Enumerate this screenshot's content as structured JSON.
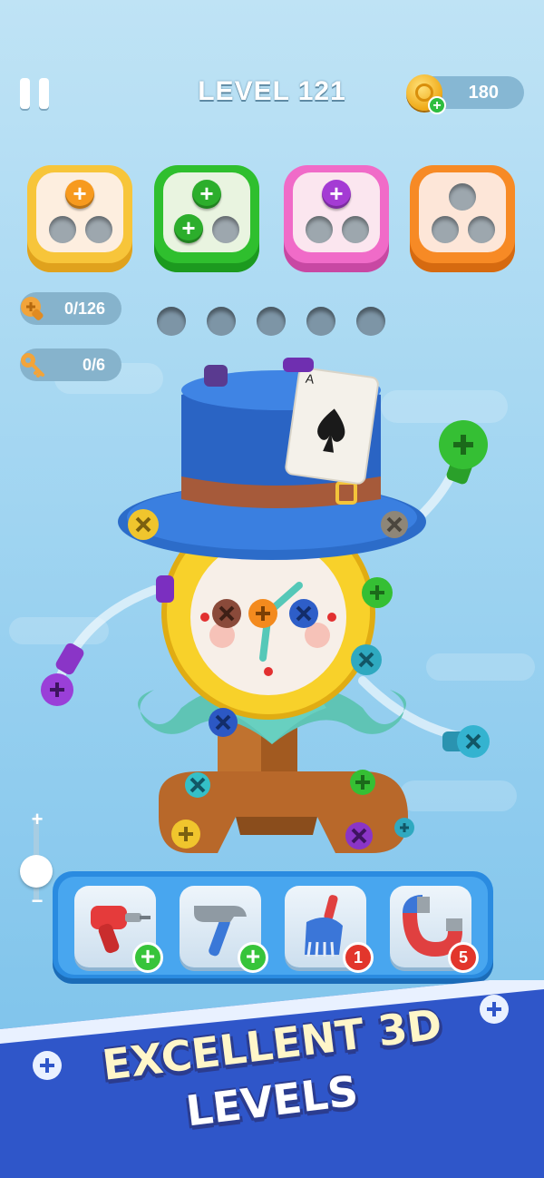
{
  "hud": {
    "level_label": "LEVEL 121",
    "coins": "180"
  },
  "counters": {
    "screws": "0/126",
    "keys": "0/6"
  },
  "colors": {
    "yellow_box": "#f7c53a",
    "green_box": "#2fbf2e",
    "pink_box": "#f06bc8",
    "orange_box": "#f78a25"
  },
  "boxes": [
    {
      "name": "yellow-box",
      "filled": 1
    },
    {
      "name": "green-box",
      "filled": 2
    },
    {
      "name": "pink-box",
      "filled": 1
    },
    {
      "name": "orange-box",
      "filled": 0
    }
  ],
  "tools": [
    {
      "name": "drill",
      "icon": "drill-icon",
      "badge": "+"
    },
    {
      "name": "hammer",
      "icon": "hammer-icon",
      "badge": "+"
    },
    {
      "name": "broom",
      "icon": "broom-icon",
      "badge": "1"
    },
    {
      "name": "magnet",
      "icon": "magnet-icon",
      "badge": "5"
    }
  ],
  "banner": {
    "line1": "EXCELLENT 3D",
    "line2": "LEVELS"
  }
}
